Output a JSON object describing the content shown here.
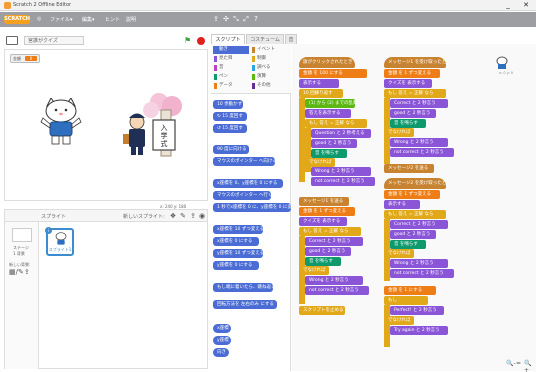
{
  "window": {
    "title": "Scratch 2 Offline Editor",
    "minimize": "_",
    "close": "✕"
  },
  "menubar": {
    "logo": "SCRATCH",
    "items": [
      "◎",
      "ファイル▾",
      "編集▾",
      "ヒント",
      "説明"
    ],
    "tools": [
      "⇪",
      "✣",
      "⤡",
      "⤢",
      "?"
    ]
  },
  "stage": {
    "title": "宮誰がクイズ",
    "version": "v1",
    "var_label": "金額",
    "var_value": "0"
  },
  "coords": {
    "x": "x: 240",
    "y": "y: 180"
  },
  "sprites": {
    "header": "スプライト",
    "new_sprite": "新しいスプライト:",
    "stage_label1": "ステージ",
    "stage_label2": "1 背景",
    "backdrop_label": "新しい背景:",
    "sprite_name": "スプライト1",
    "sprite_number": "i"
  },
  "tabs": [
    "スクリプト",
    "コスチューム",
    "音"
  ],
  "categories": [
    {
      "name": "動き",
      "color": "#4a6cd4",
      "selected": true
    },
    {
      "name": "見た目",
      "color": "#8a55d7",
      "selected": false
    },
    {
      "name": "音",
      "color": "#bb42c3",
      "selected": false
    },
    {
      "name": "ペン",
      "color": "#0e9a6c",
      "selected": false
    },
    {
      "name": "データ",
      "color": "#ee7d16",
      "selected": false
    },
    {
      "name": "イベント",
      "color": "#c88330",
      "selected": false
    },
    {
      "name": "制御",
      "color": "#e1a91a",
      "selected": false
    },
    {
      "name": "調べる",
      "color": "#2ca5e2",
      "selected": false
    },
    {
      "name": "演算",
      "color": "#5cb712",
      "selected": false
    },
    {
      "name": "その他",
      "color": "#632d99",
      "selected": false
    }
  ],
  "palette_blocks": [
    {
      "text": "10 歩動かす",
      "kind": "motion"
    },
    {
      "text": "↻ 15 度回す",
      "kind": "motion"
    },
    {
      "text": "↺ 15 度回す",
      "kind": "motion"
    },
    {
      "text": "90 度に向ける",
      "kind": "motion"
    },
    {
      "text": "マウスのポインター へ向ける",
      "kind": "motion"
    },
    {
      "text": "x座標を 0、y座標を 0 にする",
      "kind": "motion"
    },
    {
      "text": "マウスのポインター へ行く",
      "kind": "motion"
    },
    {
      "text": "1 秒でx座標を 0 に、y座標を 0 に変える",
      "kind": "motion"
    },
    {
      "text": "x座標を 10 ずつ変える",
      "kind": "motion"
    },
    {
      "text": "x座標を 0 にする",
      "kind": "motion"
    },
    {
      "text": "y座標を 10 ずつ変える",
      "kind": "motion"
    },
    {
      "text": "y座標を 0 にする",
      "kind": "motion"
    },
    {
      "text": "もし端に着いたら、跳ね返る",
      "kind": "motion"
    },
    {
      "text": "回転方法を 左右のみ にする",
      "kind": "motion"
    },
    {
      "text": "x座標",
      "kind": "motion"
    },
    {
      "text": "y座標",
      "kind": "motion"
    },
    {
      "text": "向き",
      "kind": "motion"
    }
  ],
  "script1": [
    {
      "text": "旗がクリックされたとき",
      "kind": "event",
      "hat": true
    },
    {
      "text": "金額 を 100 にする",
      "kind": "var"
    },
    {
      "text": "表示する",
      "kind": "looks"
    },
    {
      "text": "10 回繰り返す",
      "kind": "control"
    },
    {
      "text": "(1) から (2) までの乱数",
      "kind": "op"
    },
    {
      "text": "答えを表示する",
      "kind": "looks"
    },
    {
      "text": "もし 答え = 正解 なら",
      "kind": "control"
    },
    {
      "text": "Question と 2 秒考える",
      "kind": "looks"
    },
    {
      "text": "good と 2 秒言う",
      "kind": "looks"
    },
    {
      "text": "音 を鳴らす",
      "kind": "pen"
    },
    {
      "text": "でなければ",
      "kind": "control"
    },
    {
      "text": "Wrong と 2 秒言う",
      "kind": "looks"
    },
    {
      "text": "not correct と 2 秒言う",
      "kind": "looks"
    },
    {
      "text": "メッセージ1 を送る",
      "kind": "event"
    },
    {
      "text": "金額 を 1 ずつ変える",
      "kind": "var"
    },
    {
      "text": "クイズを 表示する",
      "kind": "looks"
    },
    {
      "text": "もし 答え = 正解 なら",
      "kind": "control"
    },
    {
      "text": "Correct と 2 秒言う",
      "kind": "looks"
    },
    {
      "text": "good と 2 秒言う",
      "kind": "looks"
    },
    {
      "text": "音 を鳴らす",
      "kind": "pen"
    },
    {
      "text": "でなければ",
      "kind": "control"
    },
    {
      "text": "Wrong と 2 秒言う",
      "kind": "looks"
    },
    {
      "text": "not correct と 2 秒言う",
      "kind": "looks"
    },
    {
      "text": "スクリプトを止める",
      "kind": "control"
    }
  ],
  "script2": [
    {
      "text": "メッセージ1 を受け取ったとき",
      "kind": "event",
      "hat": true
    },
    {
      "text": "金額 を 1 ずつ変える",
      "kind": "var"
    },
    {
      "text": "クイズを 表示する",
      "kind": "looks"
    },
    {
      "text": "もし 答え = 正解 なら",
      "kind": "control"
    },
    {
      "text": "Correct と 2 秒言う",
      "kind": "looks"
    },
    {
      "text": "good と 2 秒言う",
      "kind": "looks"
    },
    {
      "text": "音 を鳴らす",
      "kind": "pen"
    },
    {
      "text": "でなければ",
      "kind": "control"
    },
    {
      "text": "Wrong と 2 秒言う",
      "kind": "looks"
    },
    {
      "text": "not correct と 2 秒言う",
      "kind": "looks"
    },
    {
      "text": "メッセージ2 を送る",
      "kind": "event"
    }
  ],
  "script3": [
    {
      "text": "メッセージ2 を受け取ったとき",
      "kind": "event",
      "hat": true
    },
    {
      "text": "金額 を 1 ずつ変える",
      "kind": "var"
    },
    {
      "text": "表示する",
      "kind": "looks"
    },
    {
      "text": "もし 答え = 正解 なら",
      "kind": "control"
    },
    {
      "text": "Correct と 2 秒言う",
      "kind": "looks"
    },
    {
      "text": "good と 2 秒言う",
      "kind": "looks"
    },
    {
      "text": "音 を鳴らす",
      "kind": "pen"
    },
    {
      "text": "でなければ",
      "kind": "control"
    },
    {
      "text": "Wrong と 2 秒言う",
      "kind": "looks"
    },
    {
      "text": "not correct と 2 秒言う",
      "kind": "looks"
    },
    {
      "text": "金額 を 1 にする",
      "kind": "var"
    },
    {
      "text": "もし",
      "kind": "control"
    },
    {
      "text": "Perfect! と 2 秒言う",
      "kind": "looks"
    },
    {
      "text": "でなければ",
      "kind": "control"
    },
    {
      "text": "Try again と 2 秒言う",
      "kind": "looks"
    }
  ],
  "zoom": {
    "out": "🔍-",
    "reset": "=",
    "in": "🔍+"
  },
  "sprite_info": "x: 0 y: 0"
}
